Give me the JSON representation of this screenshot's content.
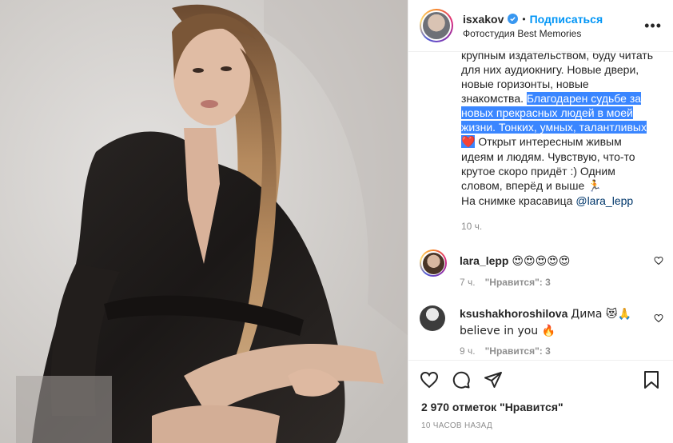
{
  "post": {
    "username": "isxakov",
    "separator": "•",
    "follow_label": "Подписаться",
    "location": "Фотостудия Best Memories",
    "more_label": "•••"
  },
  "caption": {
    "part1": "крупным издательством, буду читать для них аудиокнигу. Новые двери, новые горизонты, новые знакомства. ",
    "highlighted": "Благодарен судьбе за новых прекрасных людей в моей жизни. Тонких, умных, талантливых ",
    "highlighted_emoji": "❤️",
    "part2": " Открыт интересным живым идеям и людям. Чувствую, что-то крутое скоро придёт :) Одним словом, вперёд и выше ",
    "part2_emoji": "🏃",
    "part3": "На снимке красавица ",
    "mention": "@lara_lepp",
    "time": "10 ч."
  },
  "comments": [
    {
      "user": "lara_lepp",
      "text": "😍😍😍😍😍",
      "time": "7 ч.",
      "likes": "\"Нравится\": 3"
    },
    {
      "user": "ksushakhoroshilova",
      "text": "Дима 😻🙏 believe in you 🔥",
      "time": "9 ч.",
      "likes": "\"Нравится\": 3"
    }
  ],
  "stats": {
    "likes": "2 970 отметок \"Нравится\"",
    "posted": "10 ЧАСОВ НАЗАД"
  },
  "icons": {
    "like": "heart-icon",
    "comment": "comment-icon",
    "share": "share-icon",
    "save": "bookmark-icon"
  },
  "colors": {
    "accent": "#0095f6",
    "highlight": "#3a86ff",
    "mention": "#00376b",
    "muted": "#8e8e8e"
  }
}
